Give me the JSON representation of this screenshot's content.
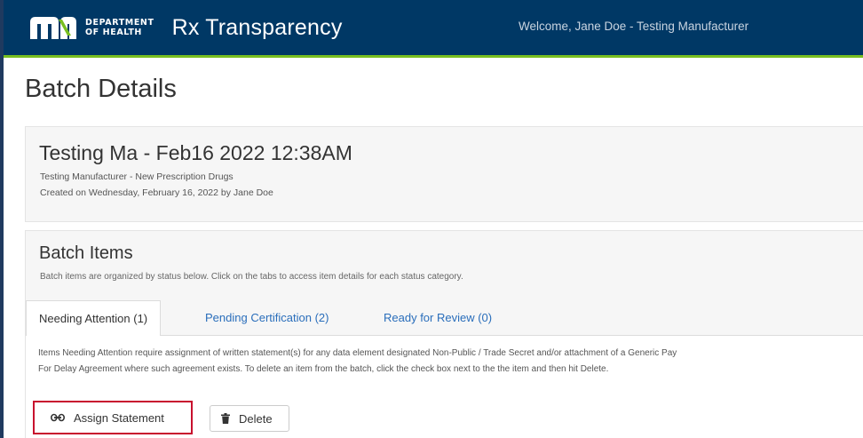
{
  "header": {
    "logo_line1": "DEPARTMENT",
    "logo_line2": "OF HEALTH",
    "app_title": "Rx Transparency",
    "welcome": "Welcome, Jane Doe - Testing Manufacturer",
    "colors": {
      "bar": "#003865",
      "accent": "#78be20"
    }
  },
  "page": {
    "title": "Batch Details"
  },
  "batch": {
    "name": "Testing Ma - Feb16 2022 12:38AM",
    "subtitle": "Testing Manufacturer - New Prescription Drugs",
    "created": "Created on Wednesday, February 16, 2022 by Jane Doe"
  },
  "items": {
    "title": "Batch Items",
    "description": "Batch items are organized by status below. Click on the tabs to access item details for each status category.",
    "tabs": [
      {
        "label": "Needing Attention (1)",
        "active": true
      },
      {
        "label": "Pending Certification (2)",
        "active": false
      },
      {
        "label": "Ready for Review (0)",
        "active": false
      }
    ],
    "panel_text_line1": "Items Needing Attention require assignment of written statement(s) for any data element designated Non-Public / Trade Secret and/or attachment of a Generic Pay",
    "panel_text_line2": "For Delay Agreement where such agreement exists. To delete an item from the batch, click the check box next to the the item and then hit Delete.",
    "buttons": {
      "assign": {
        "label": "Assign Statement",
        "icon": "link-icon"
      },
      "delete": {
        "label": "Delete",
        "icon": "trash-icon"
      }
    },
    "highlight_color": "#c8102e"
  }
}
